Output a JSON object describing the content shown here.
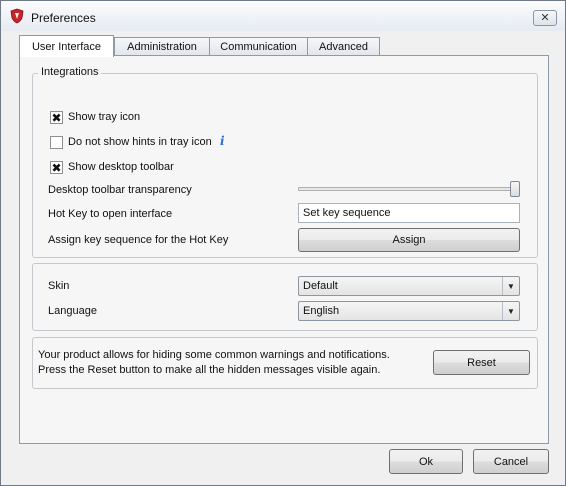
{
  "window": {
    "title": "Preferences",
    "close_glyph": "✕",
    "app_icon": "shield-app-icon"
  },
  "tabs": [
    {
      "label": "User Interface",
      "active": true
    },
    {
      "label": "Administration",
      "active": false
    },
    {
      "label": "Communication",
      "active": false
    },
    {
      "label": "Advanced",
      "active": false
    }
  ],
  "integrations": {
    "legend": "Integrations",
    "show_tray_icon": {
      "label": "Show tray icon",
      "checked": true
    },
    "no_hints": {
      "label": "Do not show hints in tray icon",
      "checked": false,
      "info_glyph": "i"
    },
    "show_desktop_toolbar": {
      "label": "Show desktop toolbar",
      "checked": true
    },
    "transparency_label": "Desktop toolbar transparency",
    "transparency_value": 1.0,
    "hotkey_label": "Hot Key to open interface",
    "hotkey_value": "Set key sequence",
    "assign_label": "Assign key sequence for the Hot Key",
    "assign_button": "Assign"
  },
  "appearance": {
    "skin_label": "Skin",
    "skin_value": "Default",
    "language_label": "Language",
    "language_value": "English"
  },
  "notice": {
    "text": "Your product allows for hiding some common warnings and notifications. Press the Reset button to make all the hidden messages visible again.",
    "reset_button": "Reset"
  },
  "footer": {
    "ok_button": "Ok",
    "cancel_button": "Cancel"
  },
  "colors": {
    "accent": "#2a6fd1",
    "shield": "#c8242b"
  },
  "checked_glyph": "✖"
}
